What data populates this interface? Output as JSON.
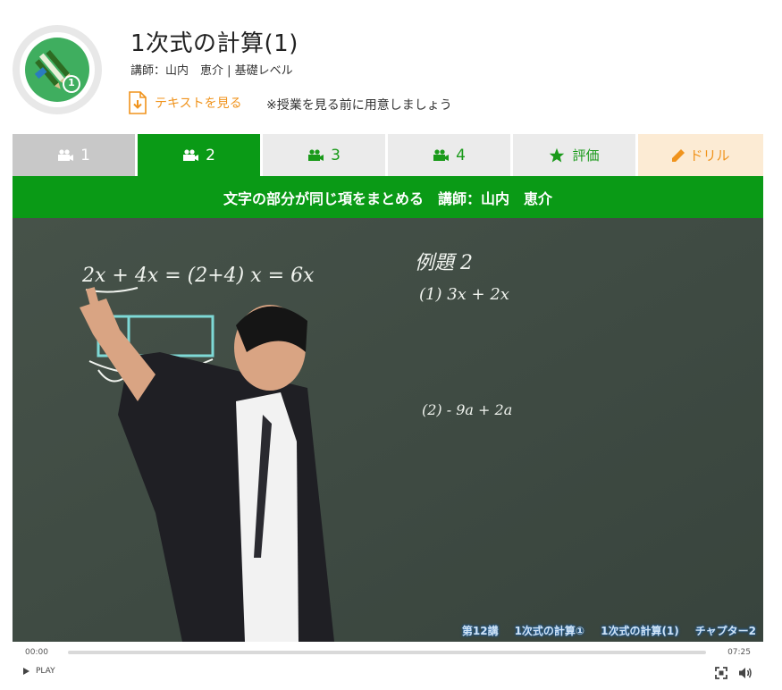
{
  "header": {
    "title": "1次式の計算(1)",
    "meta": "講師：山内　恵介 | 基礎レベル",
    "text_link_label": "テキストを見る",
    "note": "※授業を見る前に用意しましょう",
    "logo_badge": "1"
  },
  "tabs": [
    {
      "label": "1",
      "icon": "video-camera-icon",
      "state": "viewed"
    },
    {
      "label": "2",
      "icon": "video-camera-icon",
      "state": "active"
    },
    {
      "label": "3",
      "icon": "video-camera-icon",
      "state": "default"
    },
    {
      "label": "4",
      "icon": "video-camera-icon",
      "state": "default"
    },
    {
      "label": "評価",
      "icon": "star-icon",
      "state": "default"
    },
    {
      "label": "ドリル",
      "icon": "pencil-icon",
      "state": "drill"
    }
  ],
  "banner": "文字の部分が同じ項をまとめる　講師：山内　恵介",
  "video": {
    "board": {
      "line1": "2x + 4x = (2+4) x = 6x",
      "example_title": "例題 2",
      "problem1": "(1) 3x + 2x",
      "problem2": "(2) - 9a + 2a"
    },
    "caption": [
      "第12講",
      "1次式の計算①",
      "1次式の計算(1)",
      "チャプター2"
    ]
  },
  "player": {
    "current_time": "00:00",
    "total_time": "07:25",
    "progress": 0,
    "play_label": "PLAY"
  },
  "colors": {
    "green": "#0a9a16",
    "orange": "#f0931c",
    "tab_inactive": "#ebebeb",
    "tab_viewed": "#c8c8c8",
    "drill_bg": "#fcebd4",
    "chalkboard": "#3f4c44"
  }
}
